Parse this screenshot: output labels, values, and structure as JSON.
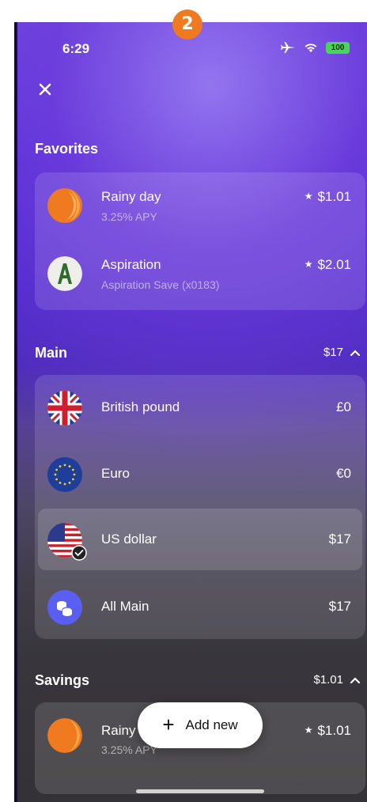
{
  "overlay_badge": "2",
  "status_bar": {
    "time": "6:29",
    "battery": "100"
  },
  "favorites": {
    "title": "Favorites",
    "items": [
      {
        "name": "Rainy day",
        "sub": "3.25% APY",
        "amount": "$1.01",
        "starred": true,
        "icon": "orange-circle-icon"
      },
      {
        "name": "Aspiration",
        "sub": "Aspiration Save (x0183)",
        "amount": "$2.01",
        "starred": true,
        "icon": "aspiration-logo-icon"
      }
    ]
  },
  "main": {
    "title": "Main",
    "total": "$17",
    "items": [
      {
        "name": "British pound",
        "amount": "£0",
        "icon": "uk-flag-icon"
      },
      {
        "name": "Euro",
        "amount": "€0",
        "icon": "eu-flag-icon"
      },
      {
        "name": "US dollar",
        "amount": "$17",
        "icon": "us-flag-icon",
        "selected": true
      },
      {
        "name": "All Main",
        "amount": "$17",
        "icon": "coins-icon"
      }
    ]
  },
  "savings": {
    "title": "Savings",
    "total": "$1.01",
    "items": [
      {
        "name": "Rainy day",
        "sub": "3.25% APY",
        "amount": "$1.01",
        "starred": true,
        "icon": "orange-circle-icon"
      }
    ]
  },
  "add_new_label": "Add new",
  "colors": {
    "accent_orange": "#f07a1f",
    "purple_top": "#6a4fe0",
    "coins_blue": "#5a5ff2"
  }
}
